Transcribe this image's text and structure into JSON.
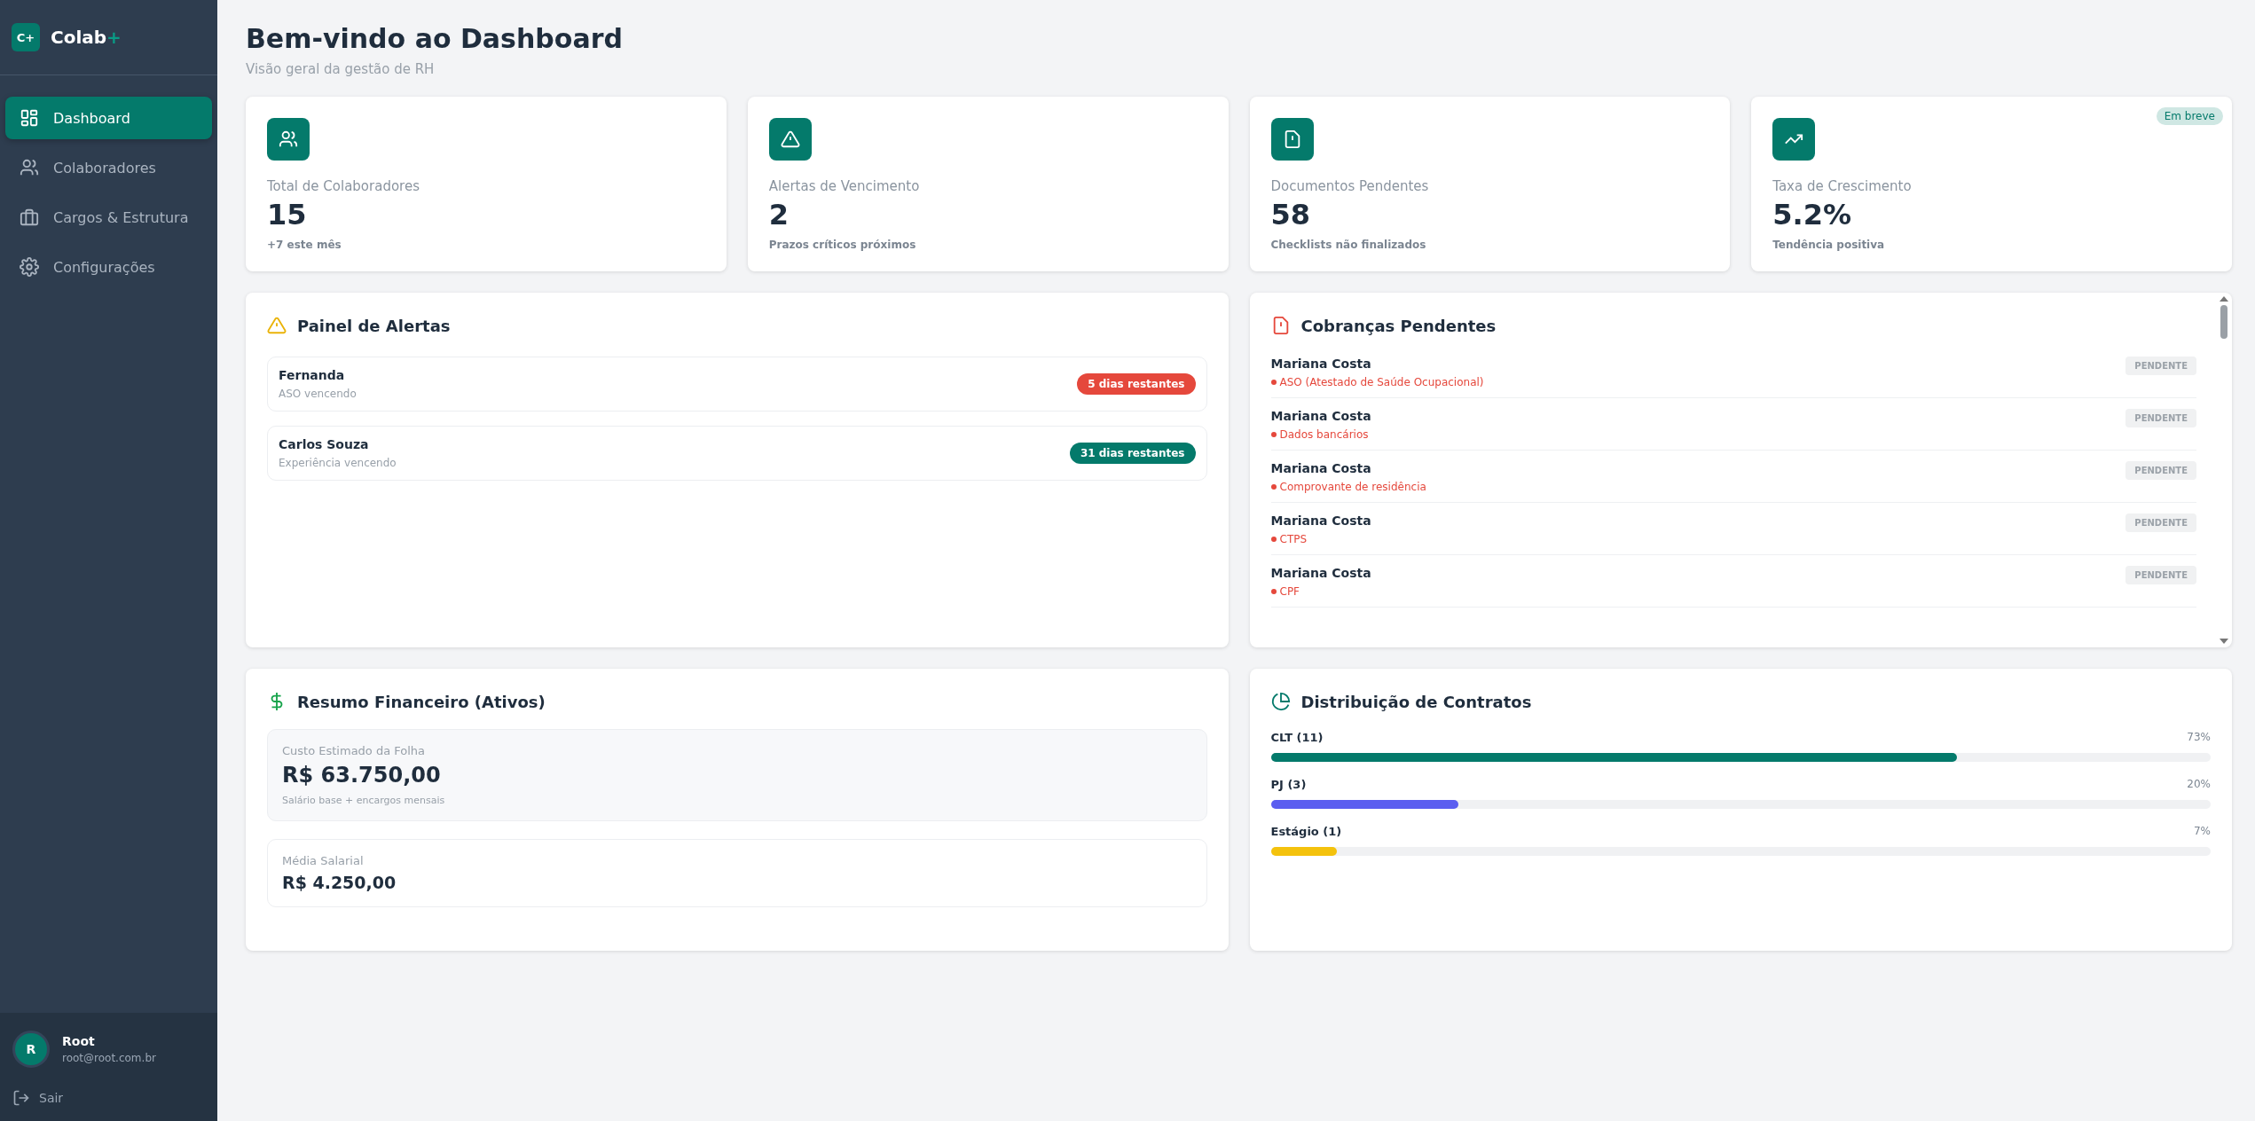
{
  "sidebar": {
    "logo_mark": "C+",
    "brand": "Colab",
    "brand_suffix": "+",
    "items": [
      {
        "label": "Dashboard",
        "selected": true
      },
      {
        "label": "Colaboradores",
        "selected": false
      },
      {
        "label": "Cargos & Estrutura",
        "selected": false
      },
      {
        "label": "Configurações",
        "selected": false
      }
    ],
    "user": {
      "initial": "R",
      "name": "Root",
      "email": "root@root.com.br"
    },
    "logout": "Sair"
  },
  "header": {
    "title": "Bem-vindo ao Dashboard",
    "subtitle": "Visão geral da gestão de RH"
  },
  "stats": [
    {
      "label": "Total de Colaboradores",
      "value": "15",
      "note": "+7 este mês"
    },
    {
      "label": "Alertas de Vencimento",
      "value": "2",
      "note": "Prazos críticos próximos"
    },
    {
      "label": "Documentos Pendentes",
      "value": "58",
      "note": "Checklists não finalizados"
    },
    {
      "label": "Taxa de Crescimento",
      "value": "5.2%",
      "note": "Tendência positiva",
      "badge": "Em breve"
    }
  ],
  "alerts": {
    "title": "Painel de Alertas",
    "items": [
      {
        "name": "Fernanda",
        "detail": "ASO vencendo",
        "remaining": "5 dias restantes",
        "color": "#e5483c"
      },
      {
        "name": "Carlos Souza",
        "detail": "Experiência vencendo",
        "remaining": "31 dias restantes",
        "color": "#047a6b"
      }
    ]
  },
  "charges": {
    "title": "Cobranças Pendentes",
    "items": [
      {
        "name": "Mariana Costa",
        "document": "ASO (Atestado de Saúde Ocupacional)",
        "status": "PENDENTE"
      },
      {
        "name": "Mariana Costa",
        "document": "Dados bancários",
        "status": "PENDENTE"
      },
      {
        "name": "Mariana Costa",
        "document": "Comprovante de residência",
        "status": "PENDENTE"
      },
      {
        "name": "Mariana Costa",
        "document": "CTPS",
        "status": "PENDENTE"
      },
      {
        "name": "Mariana Costa",
        "document": "CPF",
        "status": "PENDENTE"
      }
    ]
  },
  "finance": {
    "title": "Resumo Financeiro (Ativos)",
    "payroll": {
      "label": "Custo Estimado da Folha",
      "value": "R$ 63.750,00",
      "note": "Salário base + encargos mensais"
    },
    "average": {
      "label": "Média Salarial",
      "value": "R$ 4.250,00"
    }
  },
  "contracts": {
    "title": "Distribuição de Contratos",
    "items": [
      {
        "label": "CLT (11)",
        "percent": "73%",
        "level": 0.73,
        "color": "#047a6b"
      },
      {
        "label": "PJ (3)",
        "percent": "20%",
        "level": 0.2,
        "color": "#5b5ef0"
      },
      {
        "label": "Estágio (1)",
        "percent": "7%",
        "level": 0.07,
        "color": "#f4c20d"
      }
    ]
  }
}
